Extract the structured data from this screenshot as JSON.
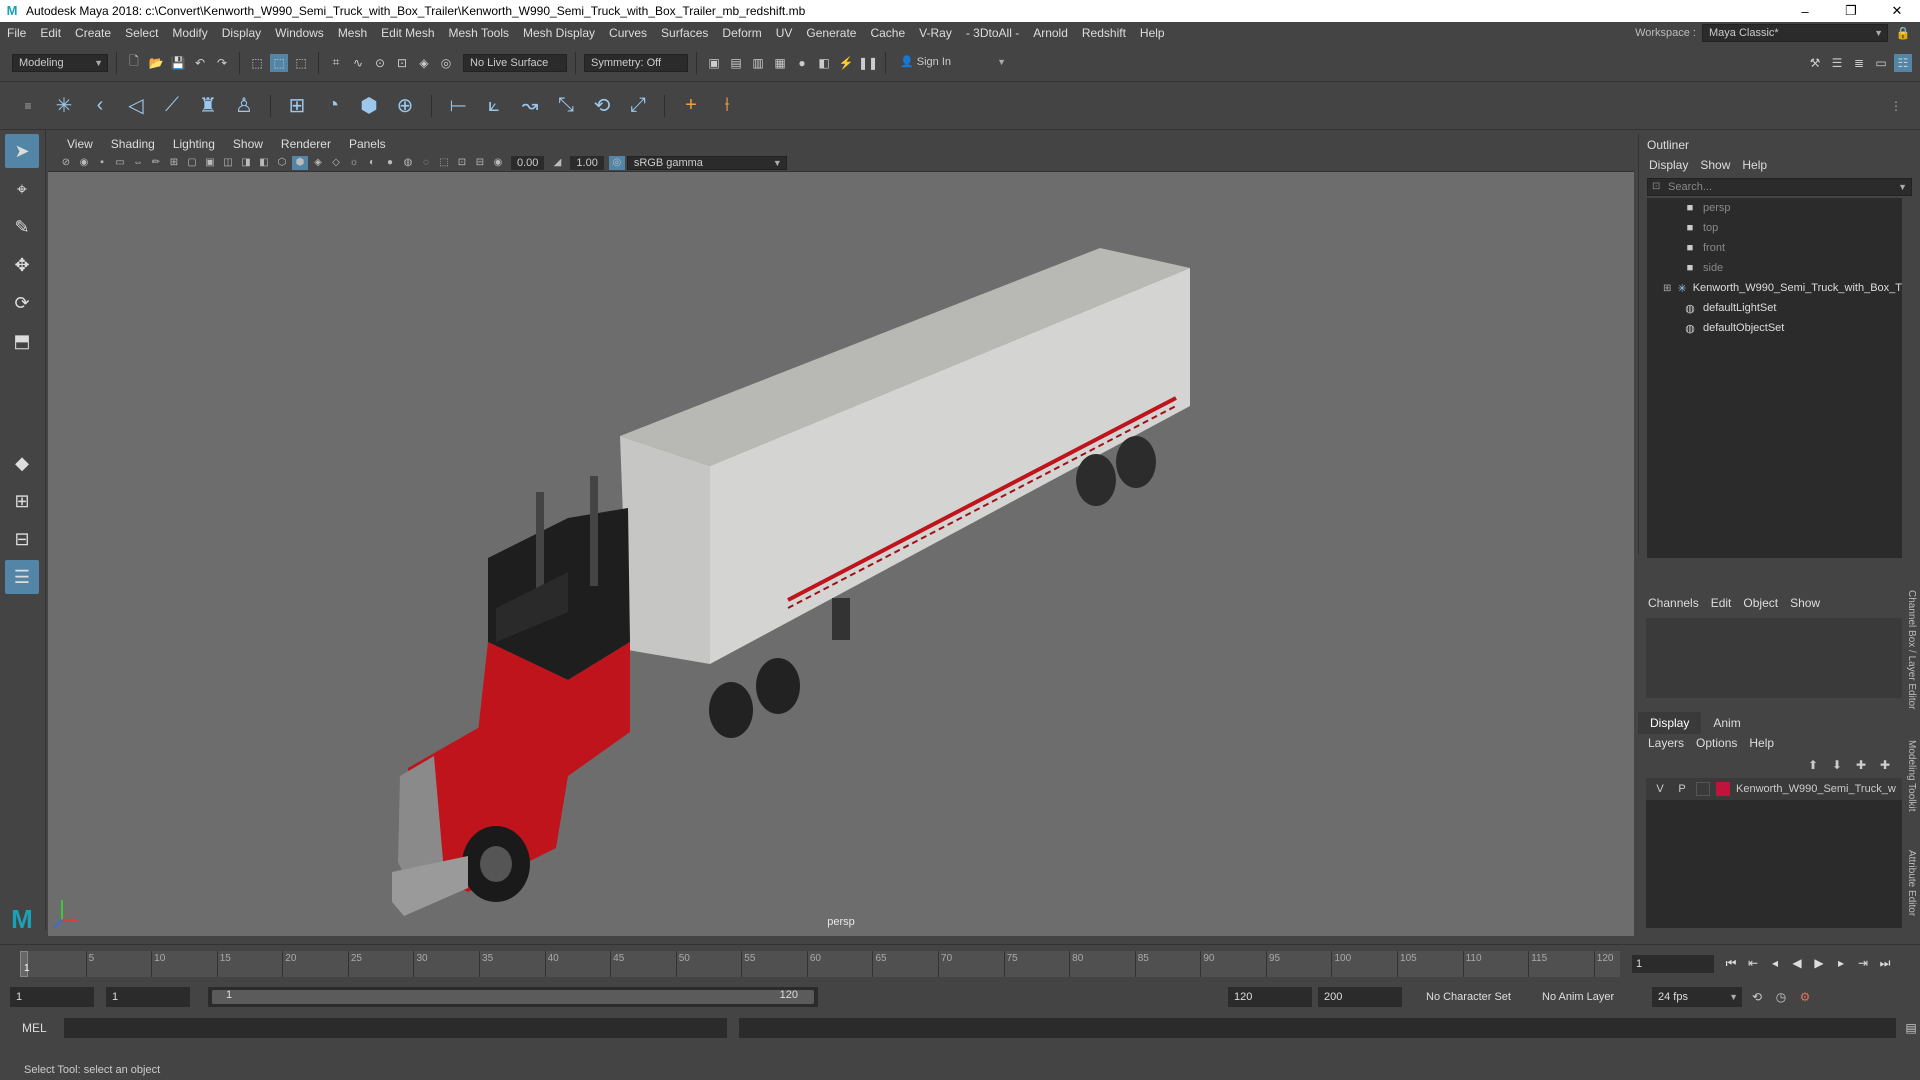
{
  "window": {
    "title": "Autodesk Maya 2018: c:\\Convert\\Kenworth_W990_Semi_Truck_with_Box_Trailer\\Kenworth_W990_Semi_Truck_with_Box_Trailer_mb_redshift.mb",
    "minimize": "–",
    "maximize": "❐",
    "close": "✕"
  },
  "menubar": {
    "items": [
      "File",
      "Edit",
      "Create",
      "Select",
      "Modify",
      "Display",
      "Windows",
      "Mesh",
      "Edit Mesh",
      "Mesh Tools",
      "Mesh Display",
      "Curves",
      "Surfaces",
      "Deform",
      "UV",
      "Generate",
      "Cache",
      "V-Ray",
      "- 3DtoAll -",
      "Arnold",
      "Redshift",
      "Help"
    ],
    "workspace_label": "Workspace :",
    "workspace_value": "Maya Classic*"
  },
  "statusline": {
    "mode": "Modeling",
    "live_surface": "No Live Surface",
    "symmetry": "Symmetry: Off",
    "sign_in": "Sign In"
  },
  "viewport": {
    "menu": [
      "View",
      "Shading",
      "Lighting",
      "Show",
      "Renderer",
      "Panels"
    ],
    "exposure": "0.00",
    "gamma": "1.00",
    "color_space": "sRGB gamma",
    "camera_label": "persp"
  },
  "outliner": {
    "title": "Outliner",
    "menu": [
      "Display",
      "Show",
      "Help"
    ],
    "search_placeholder": "Search...",
    "items": [
      {
        "label": "persp",
        "icon": "camera-icon",
        "dim": true
      },
      {
        "label": "top",
        "icon": "camera-icon",
        "dim": true
      },
      {
        "label": "front",
        "icon": "camera-icon",
        "dim": true
      },
      {
        "label": "side",
        "icon": "camera-icon",
        "dim": true
      },
      {
        "label": "Kenworth_W990_Semi_Truck_with_Box_T",
        "icon": "transform-icon",
        "dim": false
      },
      {
        "label": "defaultLightSet",
        "icon": "set-icon",
        "dim": false
      },
      {
        "label": "defaultObjectSet",
        "icon": "set-icon",
        "dim": false
      }
    ]
  },
  "channelbox": {
    "menu": [
      "Channels",
      "Edit",
      "Object",
      "Show"
    ]
  },
  "layereditor": {
    "tabs": [
      "Display",
      "Anim"
    ],
    "menu": [
      "Layers",
      "Options",
      "Help"
    ],
    "layer": {
      "v": "V",
      "p": "P",
      "name": "Kenworth_W990_Semi_Truck_w",
      "color": "#c0143c"
    }
  },
  "side_tabs": [
    "Channel Box / Layer Editor",
    "Modeling Toolkit",
    "Attribute Editor"
  ],
  "timeline": {
    "ticks": [
      5,
      10,
      15,
      20,
      25,
      30,
      35,
      40,
      45,
      50,
      55,
      60,
      65,
      70,
      75,
      80,
      85,
      90,
      95,
      100,
      105,
      110,
      115,
      120
    ],
    "start_tick": "1",
    "current_frame": "1"
  },
  "range": {
    "start": "1",
    "current": "1",
    "range_start": "1",
    "range_end": "120",
    "end": "120",
    "max": "200",
    "character_set": "No Character Set",
    "anim_layer": "No Anim Layer",
    "fps": "24 fps"
  },
  "command": {
    "label": "MEL"
  },
  "help_line": "Select Tool: select an object",
  "colors": {
    "accent": "#5285a6",
    "truck_red": "#c0141c",
    "trailer": "#d8d8d8"
  }
}
